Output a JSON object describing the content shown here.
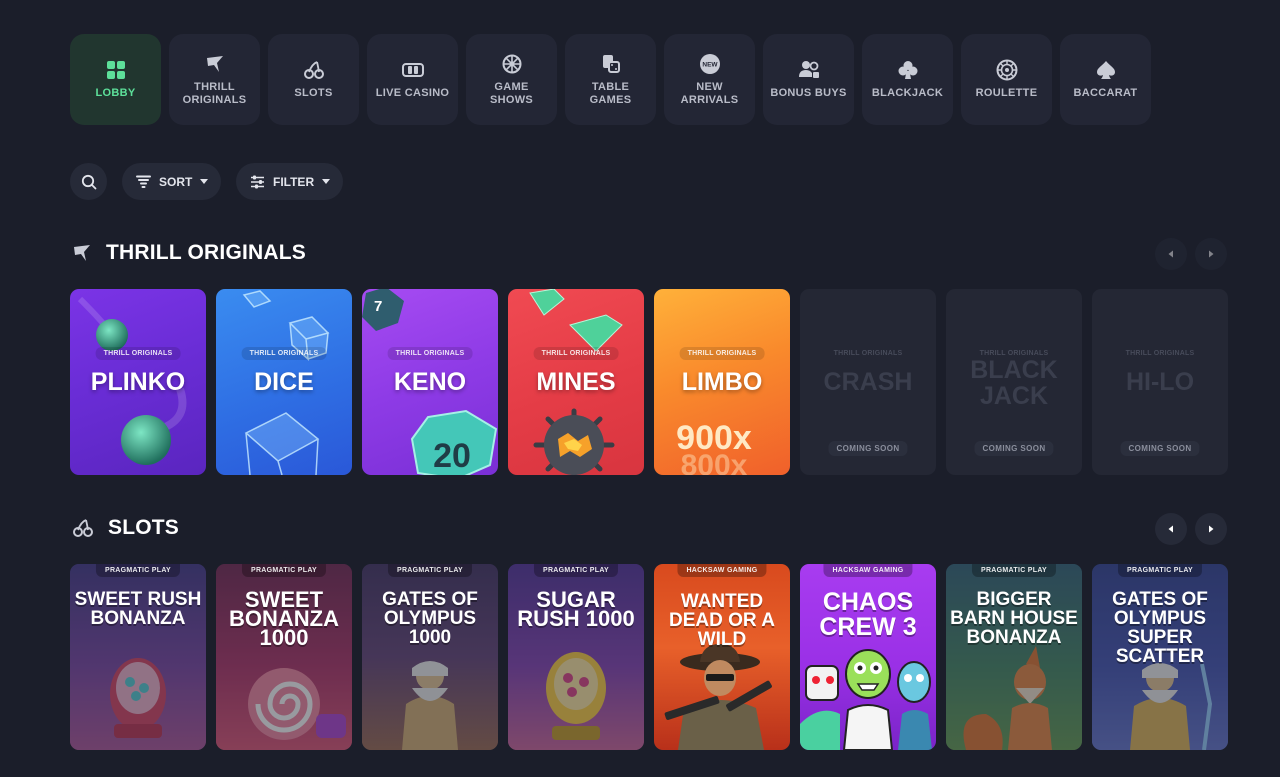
{
  "categories": [
    {
      "label": "LOBBY",
      "icon": "grid-icon",
      "active": true
    },
    {
      "label": "THRILL ORIGINALS",
      "icon": "thrill-logo-icon"
    },
    {
      "label": "SLOTS",
      "icon": "cherries-icon"
    },
    {
      "label": "LIVE CASINO",
      "icon": "live-cards-icon"
    },
    {
      "label": "GAME SHOWS",
      "icon": "wheel-icon"
    },
    {
      "label": "TABLE GAMES",
      "icon": "table-games-icon"
    },
    {
      "label": "NEW ARRIVALS",
      "icon": "new-badge-icon",
      "badge": "NEW"
    },
    {
      "label": "BONUS BUYS",
      "icon": "bonus-buys-icon"
    },
    {
      "label": "BLACKJACK",
      "icon": "club-icon"
    },
    {
      "label": "ROULETTE",
      "icon": "roulette-icon"
    },
    {
      "label": "BACCARAT",
      "icon": "spade-icon"
    }
  ],
  "toolbar": {
    "sort_label": "SORT",
    "filter_label": "FILTER"
  },
  "originals": {
    "title": "THRILL ORIGINALS",
    "cards": [
      {
        "tag": "THRILL ORIGINALS",
        "name": "PLINKO",
        "status": "available"
      },
      {
        "tag": "THRILL ORIGINALS",
        "name": "DICE",
        "status": "available"
      },
      {
        "tag": "THRILL ORIGINALS",
        "name": "KENO",
        "status": "available",
        "ball_number": "20",
        "corner_number": "7"
      },
      {
        "tag": "THRILL ORIGINALS",
        "name": "MINES",
        "status": "available"
      },
      {
        "tag": "THRILL ORIGINALS",
        "name": "LIMBO",
        "status": "available",
        "multiplier_main": "900x",
        "multiplier_sub": "800x"
      },
      {
        "tag": "THRILL ORIGINALS",
        "name": "CRASH",
        "status": "COMING SOON"
      },
      {
        "tag": "THRILL ORIGINALS",
        "name": "BLACK JACK",
        "status": "COMING SOON"
      },
      {
        "tag": "THRILL ORIGINALS",
        "name": "HI-LO",
        "status": "COMING SOON"
      }
    ]
  },
  "slots": {
    "title": "SLOTS",
    "cards": [
      {
        "provider": "PRAGMATIC PLAY",
        "title": "SWEET RUSH BONANZA"
      },
      {
        "provider": "PRAGMATIC PLAY",
        "title": "SWEET BONANZA 1000"
      },
      {
        "provider": "PRAGMATIC PLAY",
        "title": "GATES OF OLYMPUS 1000"
      },
      {
        "provider": "PRAGMATIC PLAY",
        "title": "SUGAR RUSH 1000"
      },
      {
        "provider": "HACKSAW GAMING",
        "title": "WANTED DEAD OR A WILD"
      },
      {
        "provider": "HACKSAW GAMING",
        "title": "CHAOS CREW 3"
      },
      {
        "provider": "PRAGMATIC PLAY",
        "title": "BIGGER BARN HOUSE BONANZA"
      },
      {
        "provider": "PRAGMATIC PLAY",
        "title": "GATES OF OLYMPUS SUPER SCATTER"
      }
    ]
  },
  "colors": {
    "background": "#1b1e2a",
    "accent": "#5de09a",
    "panel": "#232635"
  }
}
